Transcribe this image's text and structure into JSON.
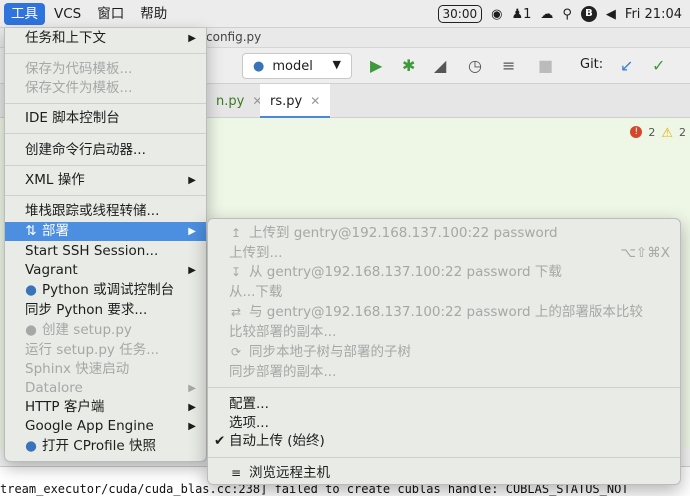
{
  "menubar": {
    "items": [
      "工具",
      "VCS",
      "窗口",
      "帮助"
    ],
    "time_badge": "30:00",
    "notification_count": "1",
    "clock": "Fri 21:04"
  },
  "ide": {
    "title": "config.py",
    "run_config": "model",
    "git_label": "Git:",
    "tabs": [
      {
        "label": "n.py"
      },
      {
        "label": "rs.py"
      }
    ],
    "inspection": {
      "errors": "2",
      "warnings": "2"
    },
    "console_text": "tream_executor/cuda/cuda_blas.cc:238] failed to create cublas handle: CUBLAS_STATUS_NOT"
  },
  "tools_menu": {
    "items": [
      {
        "label": "任务和上下文",
        "submenu": true
      },
      {
        "label": "保存为代码模板...",
        "disabled": true
      },
      {
        "label": "保存文件为模板...",
        "disabled": true
      },
      {
        "label": "IDE 脚本控制台"
      },
      {
        "label": "创建命令行启动器..."
      },
      {
        "label": "XML 操作",
        "submenu": true
      },
      {
        "label": "堆栈跟踪或线程转储..."
      },
      {
        "label": "部署",
        "submenu": true,
        "highlighted": true
      },
      {
        "label": "Start SSH Session..."
      },
      {
        "label": "Vagrant",
        "submenu": true
      },
      {
        "label": "Python 或调试控制台"
      },
      {
        "label": "同步 Python 要求..."
      },
      {
        "label": "创建 setup.py",
        "disabled": true
      },
      {
        "label": "运行 setup.py 任务...",
        "disabled": true
      },
      {
        "label": "Sphinx 快速启动",
        "disabled": true
      },
      {
        "label": "Datalore",
        "submenu": true,
        "disabled": true
      },
      {
        "label": "HTTP 客户端",
        "submenu": true
      },
      {
        "label": "Google App Engine",
        "submenu": true
      },
      {
        "label": "打开 CProfile 快照"
      }
    ]
  },
  "deploy_submenu": {
    "items": [
      {
        "label": "上传到 gentry@192.168.137.100:22 password",
        "disabled": true
      },
      {
        "label": "上传到...",
        "disabled": true,
        "shortcut": "⌥⇧⌘X"
      },
      {
        "label": "从 gentry@192.168.137.100:22 password 下载",
        "disabled": true
      },
      {
        "label": "从...下载",
        "disabled": true
      },
      {
        "label": "与 gentry@192.168.137.100:22 password 上的部署版本比较",
        "disabled": true
      },
      {
        "label": "比较部署的副本...",
        "disabled": true
      },
      {
        "label": "同步本地子树与部署的子树",
        "disabled": true
      },
      {
        "label": "同步部署的副本...",
        "disabled": true
      },
      {
        "label": "配置..."
      },
      {
        "label": "选项..."
      },
      {
        "label": "自动上传 (始终)",
        "checked": true
      },
      {
        "label": "浏览远程主机"
      }
    ]
  },
  "colors": {
    "highlight": "#4c8edf",
    "menu_bg": "#e8ebe6",
    "disabled_text": "#a7a7a7"
  }
}
